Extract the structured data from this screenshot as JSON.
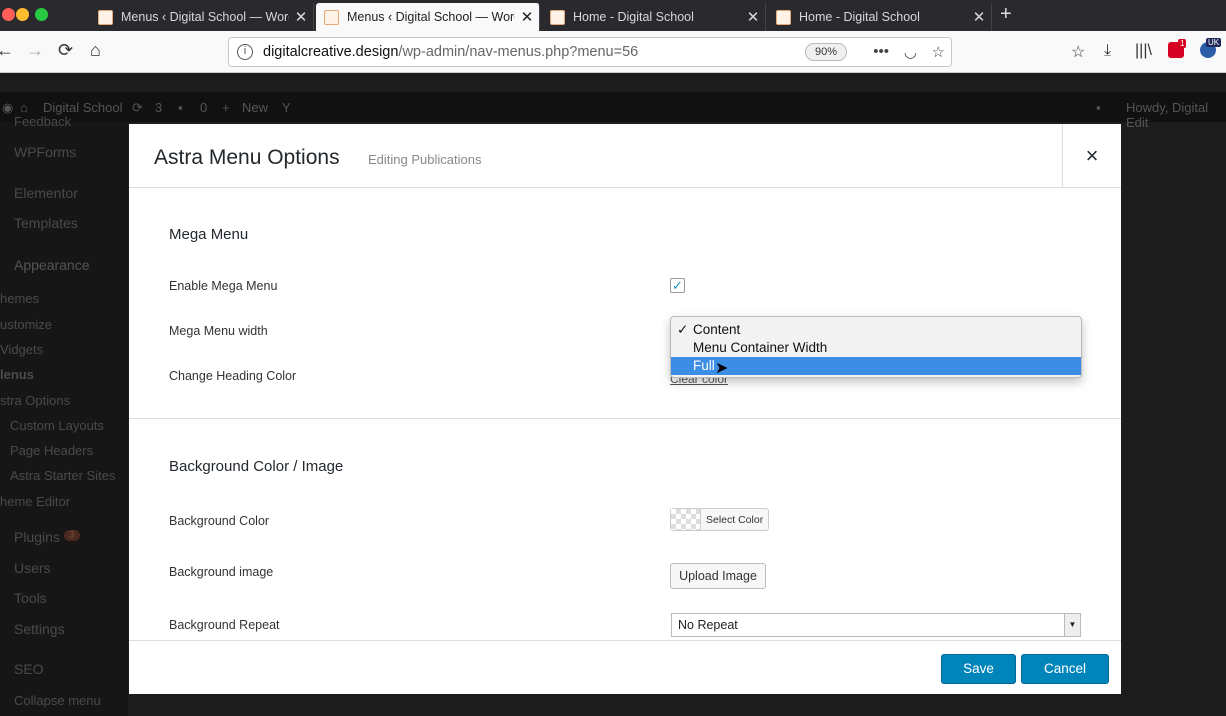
{
  "browser": {
    "tabs": [
      {
        "label": "Menus ‹ Digital School — WordPress",
        "close": "✕"
      },
      {
        "label": "Menus ‹ Digital School — WordPress",
        "close": "✕"
      },
      {
        "label": "Home - Digital School",
        "close": "✕"
      },
      {
        "label": "Home - Digital School",
        "close": "✕"
      }
    ],
    "new_tab": "+",
    "url_domain": "digitalcreative.design",
    "url_path": "/wp-admin/nav-menus.php?menu=56",
    "zoom": "90%",
    "ext_badge_red": "1",
    "ext_badge_uk": "UK"
  },
  "admin_bar": {
    "site_name": "Digital School",
    "updates": "3",
    "comments": "0",
    "new_label": "New",
    "howdy": "Howdy, Digital Edit"
  },
  "sidebar": {
    "feedback": "Feedback",
    "wpforms": "WPForms",
    "elementor": "Elementor",
    "templates": "Templates",
    "appearance": "Appearance",
    "themes": "hemes",
    "customize": "ustomize",
    "widgets": "Vidgets",
    "menus": "lenus",
    "astra_options": "stra Options",
    "custom_layouts": "Custom Layouts",
    "page_headers": "Page Headers",
    "astra_starter_sites": "Astra Starter Sites",
    "theme_editor": "heme Editor",
    "plugins": "Plugins",
    "plugins_count": "3",
    "users": "Users",
    "tools": "Tools",
    "settings": "Settings",
    "seo": "SEO",
    "collapse": "Collapse menu"
  },
  "modal": {
    "title": "Astra Menu Options",
    "subtitle": "Editing Publications",
    "close": "×",
    "mega_menu_heading": "Mega Menu",
    "enable_label": "Enable Mega Menu",
    "enable_checked": true,
    "check_mark": "✓",
    "width_label": "Mega Menu width",
    "width_options": [
      {
        "label": "Content",
        "mark": "✓"
      },
      {
        "label": "Menu Container Width",
        "mark": ""
      },
      {
        "label": "Full",
        "mark": ""
      }
    ],
    "heading_color_label": "Change Heading Color",
    "clear_link": "Clear color",
    "bg_heading": "Background Color / Image",
    "bg_color_label": "Background Color",
    "select_color": "Select Color",
    "bg_image_label": "Background image",
    "upload_image": "Upload Image",
    "bg_repeat_label": "Background Repeat",
    "bg_repeat_value": "No Repeat",
    "save": "Save",
    "cancel": "Cancel"
  }
}
